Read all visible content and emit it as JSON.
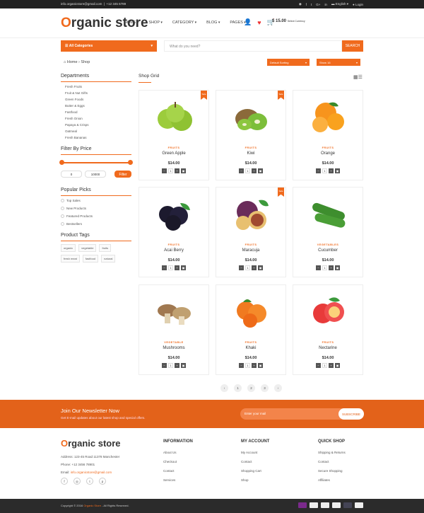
{
  "topbar": {
    "email": "info.organicstore@gmail.com",
    "phone": "+12 345 6789",
    "language": "English",
    "login": "Login"
  },
  "header": {
    "logo_o": "O",
    "logo_rest": "rganic store",
    "nav": [
      "HOME",
      "SHOP",
      "CATEGORY",
      "BLOG",
      "PAGES"
    ],
    "cart_total": "$ 15.00",
    "currency_label": "Select Currency"
  },
  "search": {
    "categories_label": "All Categories",
    "placeholder": "What do you need?",
    "button": "SEARCH"
  },
  "breadcrumb": {
    "home": "Home",
    "current": "Shop"
  },
  "sort": {
    "sort_label": "Default Sorting",
    "show_label": "Show 16"
  },
  "sidebar": {
    "departments_title": "Departments",
    "departments": [
      "Fresh Fruits",
      "Fruit & Nut Gifts",
      "Green Foods",
      "Butter & Eggs",
      "Fastfood",
      "Fresh Onion",
      "Papaya & Crisps",
      "Oatmeal",
      "Fresh Bananas"
    ],
    "price_title": "Filter By Price",
    "price_min": "0",
    "price_max": "10000",
    "filter_button": "Filter",
    "popular_title": "Popular Picks",
    "popular": [
      "Top Sales",
      "New Products",
      "Featured Products",
      "Bestsellers"
    ],
    "tags_title": "Product Tags",
    "tags": [
      "organic",
      "vegetable",
      "fruits",
      "fresh meat",
      "fastfood",
      "natural"
    ]
  },
  "grid": {
    "title": "Shop Grid",
    "sale_label": "Sale"
  },
  "products": [
    {
      "category": "FRUITS",
      "name": "Green Apple",
      "price": "$14.00",
      "sale": true,
      "qty": "1"
    },
    {
      "category": "FRUITS",
      "name": "Kiwi",
      "price": "$14.00",
      "sale": true,
      "qty": "1"
    },
    {
      "category": "FRUITS",
      "name": "Orange",
      "price": "$14.00",
      "sale": false,
      "qty": "1"
    },
    {
      "category": "FRUITS",
      "name": "Acai Berry",
      "price": "$14.00",
      "sale": false,
      "qty": "1"
    },
    {
      "category": "FRUITS",
      "name": "Maracuja",
      "price": "$14.00",
      "sale": true,
      "qty": "1"
    },
    {
      "category": "VEGETABLES",
      "name": "Cucumber",
      "price": "$14.00",
      "sale": false,
      "qty": "1"
    },
    {
      "category": "VEGETABLE",
      "name": "Mushrooms",
      "price": "$14.00",
      "sale": false,
      "qty": "1"
    },
    {
      "category": "FRUITS",
      "name": "Khaki",
      "price": "$14.00",
      "sale": false,
      "qty": "1"
    },
    {
      "category": "FRUITS",
      "name": "Nectarine",
      "price": "$14.00",
      "sale": false,
      "qty": "1"
    }
  ],
  "pagination": [
    "1",
    "2",
    "3"
  ],
  "newsletter": {
    "title": "Join Our Newsletter Now",
    "text": "Get E-mail updates about our latest shop and special offers.",
    "placeholder": "Enter your mail",
    "button": "SUBSCRIBE"
  },
  "footer": {
    "logo_o": "O",
    "logo_rest": "rganic store",
    "address": "Address: 123-45 Road 11378 Manchester",
    "phone": "Phone: +12 3456 78901",
    "email_label": "Email:",
    "email": "info.organicstore@gmail.com",
    "information": {
      "title": "INFORMATION",
      "links": [
        "About Us",
        "Checkout",
        "Contact",
        "Services"
      ]
    },
    "account": {
      "title": "MY ACCOUNT",
      "links": [
        "My Account",
        "Contact",
        "Shopping Cart",
        "Shop"
      ]
    },
    "quickshop": {
      "title": "QUICK SHOP",
      "links": [
        "Shipping & Returns",
        "Contact",
        "Secure Shopping",
        "Affiliates"
      ]
    }
  },
  "copyright": {
    "prefix": "Copyright © 2016",
    "brand": "Organic Store",
    "suffix": "- All Rights Reserved."
  },
  "colors": {
    "accent": "#f06a1d",
    "dark": "#2b2b2b"
  }
}
